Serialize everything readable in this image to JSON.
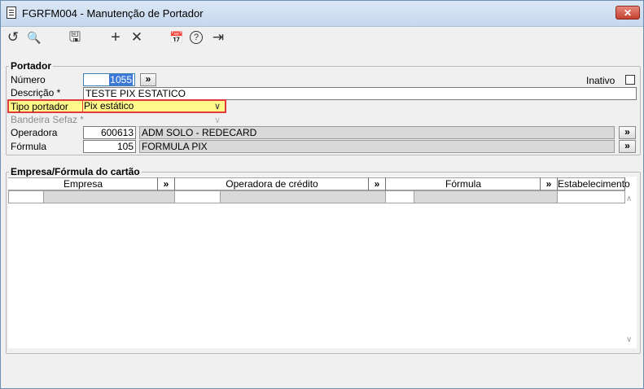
{
  "window": {
    "title": "FGRFM004 - Manutenção de Portador",
    "close_glyph": "✕"
  },
  "toolbar": {
    "items": [
      {
        "name": "undo-icon",
        "glyph": "↺"
      },
      {
        "name": "search-icon",
        "glyph": "🔍"
      },
      {
        "name": "save-icon",
        "glyph": "🖫"
      },
      {
        "name": "add-icon",
        "glyph": "+"
      },
      {
        "name": "delete-icon",
        "glyph": "✕"
      },
      {
        "name": "calendar-icon",
        "glyph": "📅"
      },
      {
        "name": "help-icon",
        "glyph": "?"
      },
      {
        "name": "exit-icon",
        "glyph": "⇥"
      }
    ]
  },
  "portador": {
    "section_title": "Portador",
    "numero_label": "Número",
    "numero_value": "1055",
    "descricao_label": "Descrição *",
    "descricao_value": "TESTE PIX ESTATICO",
    "tipo_label": "Tipo portador",
    "tipo_value": "Pix estático",
    "bandeira_label": "Bandeira Sefaz *",
    "bandeira_value": "",
    "operadora_label": "Operadora",
    "operadora_code": "600613",
    "operadora_name": "ADM SOLO - REDECARD",
    "formula_label": "Fórmula",
    "formula_code": "105",
    "formula_name": "FORMULA PIX",
    "inativo_label": "Inativo",
    "lookup_glyph": "»"
  },
  "empresa_formula": {
    "section_title": "Empresa/Fórmula do cartão",
    "columns": [
      "Empresa",
      "Operadora de crédito",
      "Fórmula",
      "Estabelecimento"
    ],
    "lookup_glyph": "»"
  },
  "colors": {
    "highlight_border": "#e0393e",
    "highlight_fill": "#fff98c",
    "selection_blue": "#3b78d8"
  }
}
